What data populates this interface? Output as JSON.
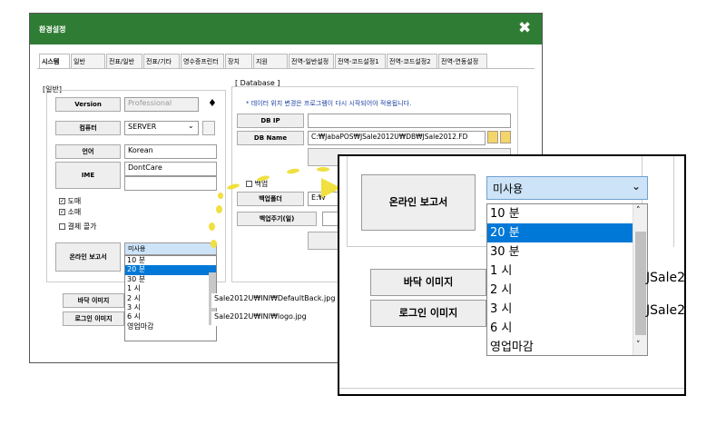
{
  "window": {
    "title": "환경설정",
    "close_icon": "✖"
  },
  "tabs": [
    "시스템",
    "일반",
    "전표/일반",
    "전표/기타",
    "영수증프린터",
    "장치",
    "지원",
    "전역-일반설정",
    "전역-코드설정1",
    "전역-코드설정2",
    "전역-연동설정"
  ],
  "general": {
    "group_label": "[일반]",
    "version_label": "Version",
    "version_value": "Professional",
    "computer_label": "컴퓨터",
    "computer_value": "SERVER",
    "language_label": "언어",
    "language_value": "Korean",
    "ime_label": "IME",
    "ime_value": "DontCare",
    "check_wholesale": "도매",
    "check_retail": "소매",
    "check_payment_close": "결제 콜가",
    "online_report_label": "온라인 보고서",
    "online_report_value": "미사용",
    "options": [
      "10 분",
      "20 분",
      "30 분",
      "1 시",
      "2 시",
      "3 시",
      "6 시",
      "영업마감"
    ],
    "selected_option": "20 분",
    "floor_image_label": "바닥 이미지",
    "login_image_label": "로그인 이미지",
    "floor_image_path": "Sale2012U₩INI₩DefaultBack.jpg",
    "login_image_path": "Sale2012U₩INI₩logo.jpg"
  },
  "database": {
    "group_label": "[ Database ]",
    "notice": "* 데이터 위치 변경은 프로그램이 다시 시작되어야 적용됩니다.",
    "dbip_label": "DB IP",
    "dbip_value": "",
    "dbname_label": "DB Name",
    "dbname_value": "C:₩JabaPOS₩JSale2012U₩DB₩JSale2012.FD",
    "backup_label": "백업",
    "backup_folder_label": "백업폴더",
    "backup_folder_value": "E:₩",
    "backup_cycle_label": "백업주기(일)"
  },
  "zoom": {
    "label": "온라인 보고서",
    "value": "미사용",
    "options": [
      "10 분",
      "20 분",
      "30 분",
      "1 시",
      "2 시",
      "3 시",
      "6 시",
      "영업마감"
    ],
    "selected": "20 분",
    "floor_label": "바닥 이미지",
    "login_label": "로그인 이미지",
    "path_fragment_1": "JSale2",
    "path_fragment_2": "JSale2"
  },
  "colors": {
    "title_bar": "#2f7d35",
    "selection": "#0078d7",
    "arrow": "#f0e040"
  }
}
